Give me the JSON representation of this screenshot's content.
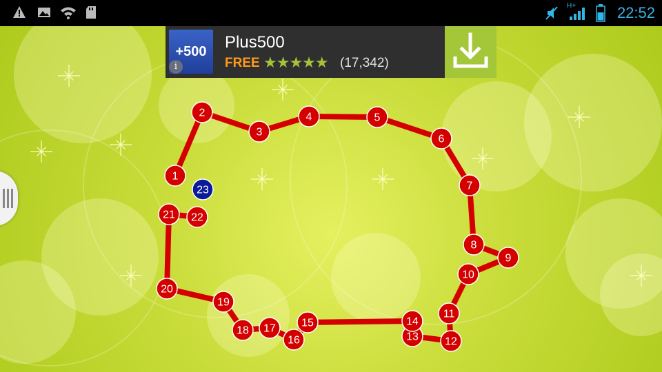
{
  "status_bar": {
    "time": "22:52",
    "network_label": "H+",
    "icons": [
      "warning-icon",
      "image-icon",
      "wifi-icon",
      "sd-card-icon",
      "mute-icon",
      "signal-icon",
      "battery-icon"
    ]
  },
  "ad": {
    "app_name": "Plus500",
    "logo_text": "+500",
    "price": "FREE",
    "stars": "★★★★★",
    "rating": 4.5,
    "review_count": "(17,342)",
    "info_symbol": "i"
  },
  "puzzle": {
    "line_color": "#d40000",
    "dot_color": "#d40000",
    "next_dot_color": "#0a1a9a",
    "connected_through": 22,
    "dots": [
      {
        "n": "1"
      },
      {
        "n": "2"
      },
      {
        "n": "3"
      },
      {
        "n": "4"
      },
      {
        "n": "5"
      },
      {
        "n": "6"
      },
      {
        "n": "7"
      },
      {
        "n": "8"
      },
      {
        "n": "9"
      },
      {
        "n": "10"
      },
      {
        "n": "11"
      },
      {
        "n": "12"
      },
      {
        "n": "13"
      },
      {
        "n": "14"
      },
      {
        "n": "15"
      },
      {
        "n": "16"
      },
      {
        "n": "17"
      },
      {
        "n": "18"
      },
      {
        "n": "19"
      },
      {
        "n": "20"
      },
      {
        "n": "21"
      },
      {
        "n": "22"
      },
      {
        "n": "23"
      }
    ]
  }
}
